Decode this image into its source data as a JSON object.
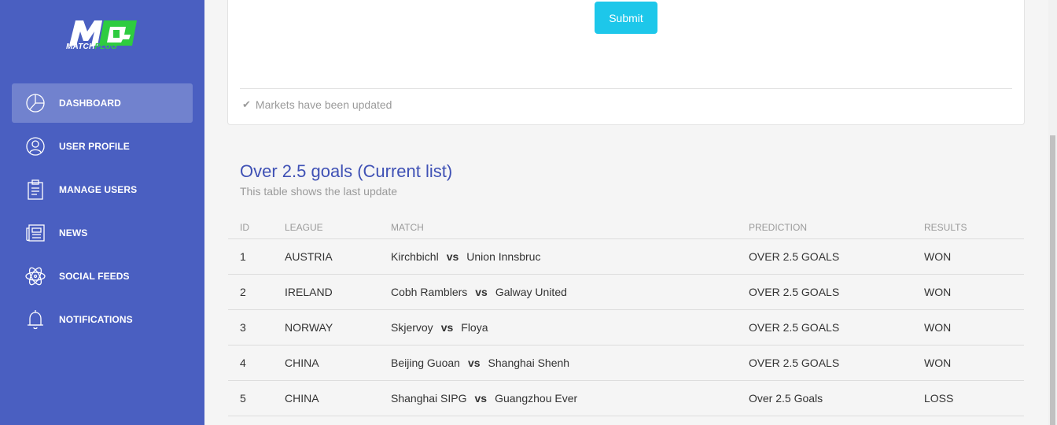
{
  "sidebar": {
    "logo_letters": "MP",
    "logo_word_main": "MATCH",
    "logo_word_accent": "PLUG",
    "items": [
      {
        "label": "DASHBOARD",
        "icon": "pie-chart-icon",
        "active": true
      },
      {
        "label": "USER PROFILE",
        "icon": "user-icon",
        "active": false
      },
      {
        "label": "MANAGE USERS",
        "icon": "clipboard-icon",
        "active": false
      },
      {
        "label": "NEWS",
        "icon": "newspaper-icon",
        "active": false
      },
      {
        "label": "SOCIAL FEEDS",
        "icon": "atom-icon",
        "active": false
      },
      {
        "label": "NOTIFICATIONS",
        "icon": "bell-icon",
        "active": false
      }
    ]
  },
  "form_card": {
    "submit_label": "Submit",
    "status_text": "Markets have been updated",
    "status_icon": "check-icon"
  },
  "table": {
    "title": "Over 2.5 goals (Current list)",
    "subtitle": "This table shows the last update",
    "headers": {
      "id": "ID",
      "league": "LEAGUE",
      "match": "MATCH",
      "prediction": "PREDICTION",
      "results": "RESULTS"
    },
    "vs_label": "vs",
    "rows": [
      {
        "id": "1",
        "league": "AUSTRIA",
        "home": "Kirchbichl",
        "away": "Union Innsbruc",
        "prediction": "OVER 2.5 GOALS",
        "result": "WON"
      },
      {
        "id": "2",
        "league": "IRELAND",
        "home": "Cobh Ramblers",
        "away": "Galway United",
        "prediction": "OVER 2.5 GOALS",
        "result": "WON"
      },
      {
        "id": "3",
        "league": "NORWAY",
        "home": "Skjervoy",
        "away": "Floya",
        "prediction": "OVER 2.5 GOALS",
        "result": "WON"
      },
      {
        "id": "4",
        "league": "CHINA",
        "home": "Beijing Guoan",
        "away": "Shanghai Shenh",
        "prediction": "OVER 2.5 GOALS",
        "result": "WON"
      },
      {
        "id": "5",
        "league": "CHINA",
        "home": "Shanghai SIPG",
        "away": "Guangzhou Ever",
        "prediction": "Over 2.5 Goals",
        "result": "LOSS"
      }
    ]
  },
  "colors": {
    "sidebar_bg": "#4a5fc1",
    "accent_title": "#3f51b5",
    "submit_bg": "#1dc7ea",
    "logo_accent": "#2ecc40"
  }
}
